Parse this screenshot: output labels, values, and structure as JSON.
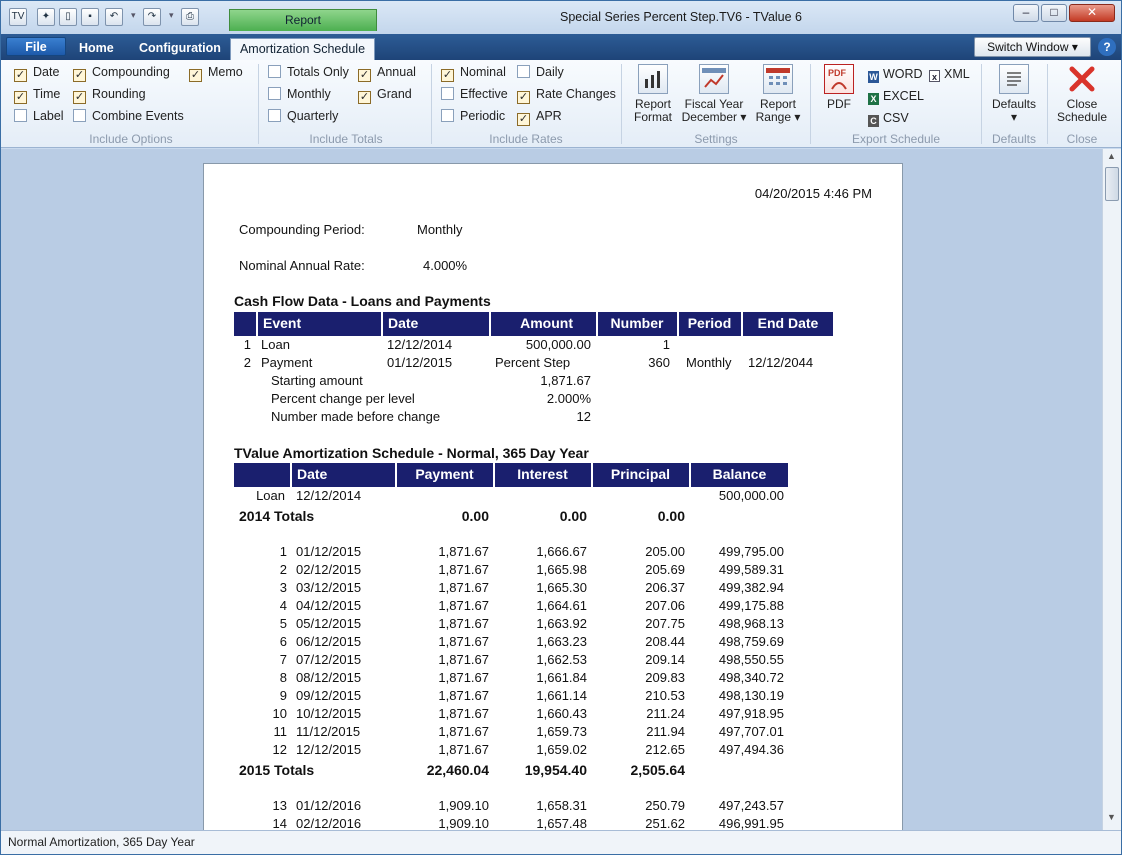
{
  "title_bar": {
    "context_tab": "Report",
    "window_title": "Special Series Percent Step.TV6 - TValue 6",
    "buttons": [
      "–",
      "□",
      "✕"
    ]
  },
  "tabs": {
    "file": "File",
    "home": "Home",
    "configuration": "Configuration",
    "amortization": "Amortization Schedule"
  },
  "switch_window": "Switch Window",
  "help": "?",
  "ribbon": {
    "include_options": {
      "label": "Include Options",
      "items": [
        {
          "label": "Date",
          "checked": true
        },
        {
          "label": "Time",
          "checked": true
        },
        {
          "label": "Label",
          "checked": false
        },
        {
          "label": "Compounding",
          "checked": true
        },
        {
          "label": "Rounding",
          "checked": true
        },
        {
          "label": "Combine Events",
          "checked": false
        },
        {
          "label": "Memo",
          "checked": true
        }
      ]
    },
    "include_totals": {
      "label": "Include Totals",
      "items": [
        {
          "label": "Totals Only",
          "checked": false
        },
        {
          "label": "Monthly",
          "checked": false
        },
        {
          "label": "Quarterly",
          "checked": false
        },
        {
          "label": "Annual",
          "checked": true
        },
        {
          "label": "Grand",
          "checked": true
        }
      ]
    },
    "include_rates": {
      "label": "Include Rates",
      "items": [
        {
          "label": "Nominal",
          "checked": true
        },
        {
          "label": "Effective",
          "checked": false
        },
        {
          "label": "Periodic",
          "checked": false
        },
        {
          "label": "Daily",
          "checked": false
        },
        {
          "label": "Rate Changes",
          "checked": true
        },
        {
          "label": "APR",
          "checked": true
        }
      ]
    },
    "settings": {
      "label": "Settings",
      "report_format": [
        "Report",
        "Format"
      ],
      "fiscal_year": [
        "Fiscal Year",
        "December ▾"
      ],
      "report_range": [
        "Report",
        "Range ▾"
      ]
    },
    "export": {
      "label": "Export Schedule",
      "pdf": "PDF",
      "word": "WORD",
      "excel": "EXCEL",
      "csv": "CSV",
      "xml": "XML"
    },
    "defaults": {
      "label": "Defaults",
      "button": "Defaults",
      "arrow": "▾"
    },
    "close": {
      "label": "Close",
      "button": [
        "Close",
        "Schedule"
      ]
    }
  },
  "report": {
    "timestamp": "04/20/2015   4:46 PM",
    "compounding_label": "Compounding Period:",
    "compounding_value": "Monthly",
    "rate_label": "Nominal Annual Rate:",
    "rate_value": "4.000%",
    "cashflow_title": "Cash Flow Data - Loans and Payments",
    "cashflow_headers": [
      "Event",
      "Date",
      "Amount",
      "Number",
      "Period",
      "End Date"
    ],
    "cashflow_rows": [
      {
        "n": "1",
        "event": "Loan",
        "date": "12/12/2014",
        "amount": "500,000.00",
        "number": "1",
        "period": "",
        "end": ""
      },
      {
        "n": "2",
        "event": "Payment",
        "date": "01/12/2015",
        "amount": "Percent Step",
        "number": "360",
        "period": "Monthly",
        "end": "12/12/2044"
      }
    ],
    "step_details": [
      {
        "label": "Starting amount",
        "value": "1,871.67"
      },
      {
        "label": "Percent change per level",
        "value": "2.000%"
      },
      {
        "label": "Number made before change",
        "value": "12"
      }
    ],
    "amort_title": "TValue Amortization Schedule - Normal, 365 Day Year",
    "amort_headers": [
      "Date",
      "Payment",
      "Interest",
      "Principal",
      "Balance"
    ],
    "loan_row": {
      "label": "Loan",
      "date": "12/12/2014",
      "balance": "500,000.00"
    },
    "totals_2014": {
      "label": "2014 Totals",
      "payment": "0.00",
      "interest": "0.00",
      "principal": "0.00"
    },
    "rows_2015": [
      [
        "1",
        "01/12/2015",
        "1,871.67",
        "1,666.67",
        "205.00",
        "499,795.00"
      ],
      [
        "2",
        "02/12/2015",
        "1,871.67",
        "1,665.98",
        "205.69",
        "499,589.31"
      ],
      [
        "3",
        "03/12/2015",
        "1,871.67",
        "1,665.30",
        "206.37",
        "499,382.94"
      ],
      [
        "4",
        "04/12/2015",
        "1,871.67",
        "1,664.61",
        "207.06",
        "499,175.88"
      ],
      [
        "5",
        "05/12/2015",
        "1,871.67",
        "1,663.92",
        "207.75",
        "498,968.13"
      ],
      [
        "6",
        "06/12/2015",
        "1,871.67",
        "1,663.23",
        "208.44",
        "498,759.69"
      ],
      [
        "7",
        "07/12/2015",
        "1,871.67",
        "1,662.53",
        "209.14",
        "498,550.55"
      ],
      [
        "8",
        "08/12/2015",
        "1,871.67",
        "1,661.84",
        "209.83",
        "498,340.72"
      ],
      [
        "9",
        "09/12/2015",
        "1,871.67",
        "1,661.14",
        "210.53",
        "498,130.19"
      ],
      [
        "10",
        "10/12/2015",
        "1,871.67",
        "1,660.43",
        "211.24",
        "497,918.95"
      ],
      [
        "11",
        "11/12/2015",
        "1,871.67",
        "1,659.73",
        "211.94",
        "497,707.01"
      ],
      [
        "12",
        "12/12/2015",
        "1,871.67",
        "1,659.02",
        "212.65",
        "497,494.36"
      ]
    ],
    "totals_2015": {
      "label": "2015 Totals",
      "payment": "22,460.04",
      "interest": "19,954.40",
      "principal": "2,505.64"
    },
    "rows_2016": [
      [
        "13",
        "01/12/2016",
        "1,909.10",
        "1,658.31",
        "250.79",
        "497,243.57"
      ],
      [
        "14",
        "02/12/2016",
        "1,909.10",
        "1,657.48",
        "251.62",
        "496,991.95"
      ]
    ]
  },
  "status": "Normal Amortization, 365 Day Year"
}
